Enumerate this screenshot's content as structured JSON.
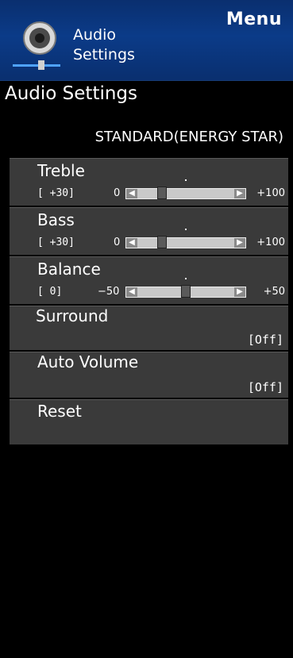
{
  "header": {
    "menu_label": "Menu",
    "title_line1": "Audio",
    "title_line2": "Settings",
    "icon": "speaker-icon"
  },
  "section_title": "Audio Settings",
  "mode": "STANDARD(ENERGY STAR)",
  "sliders": {
    "treble": {
      "label": "Treble",
      "value_text": "[ +30]",
      "min_label": "0",
      "max_label": "+100",
      "level_fraction": 0.3
    },
    "bass": {
      "label": "Bass",
      "value_text": "[ +30]",
      "min_label": "0",
      "max_label": "+100",
      "level_fraction": 0.3
    },
    "balance": {
      "label": "Balance",
      "value_text": "[    0]",
      "min_label": "−50",
      "max_label": "+50",
      "level_fraction": 0.5
    }
  },
  "items": {
    "surround": {
      "label": "Surround",
      "value": "[Off]"
    },
    "auto_volume": {
      "label": "Auto Volume",
      "value": "[Off]"
    },
    "reset": {
      "label": "Reset"
    }
  },
  "colors": {
    "header_blue": "#0b3b88",
    "item_bg": "#3a3a3a"
  }
}
